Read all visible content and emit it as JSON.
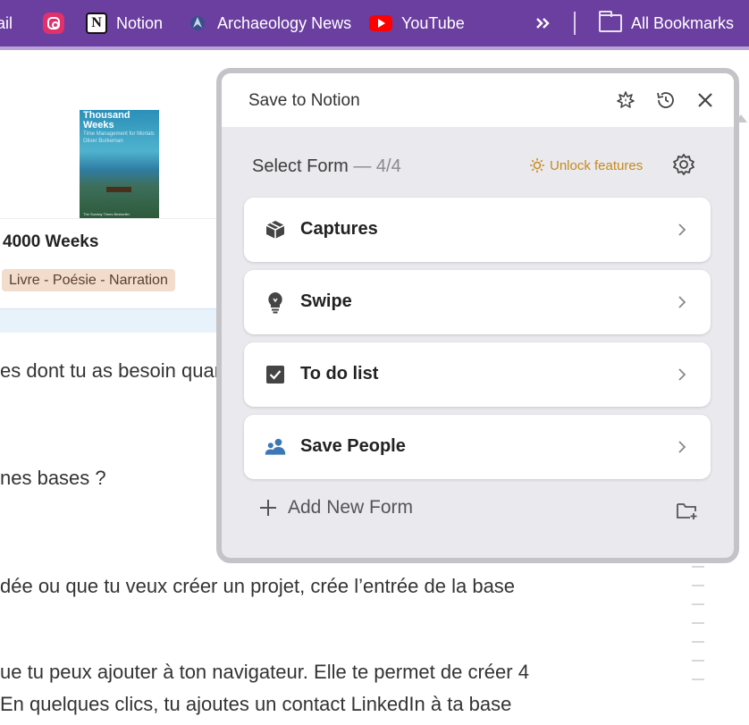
{
  "bookmarks_bar": {
    "items": [
      {
        "label": "ail",
        "icon": "mail-icon"
      },
      {
        "label": "",
        "icon": "instagram-icon"
      },
      {
        "label": "Notion",
        "icon": "notion-icon",
        "icon_glyph": "N"
      },
      {
        "label": "Archaeology News",
        "icon": "compass-icon"
      },
      {
        "label": "YouTube",
        "icon": "youtube-icon"
      }
    ],
    "overflow_icon": "double-chevron-icon",
    "all_bookmarks": {
      "label": "All Bookmarks",
      "icon": "folder-icon"
    },
    "colors": {
      "background": "#6b3fa0",
      "text": "#ffffff"
    }
  },
  "page": {
    "book": {
      "cover_title": "Thousand Weeks",
      "cover_subtitle": "Time Management for Mortals",
      "cover_author": "Oliver Burkeman",
      "cover_footer": "The Sunday Times Bestseller"
    },
    "card_title": "4000 Weeks",
    "tag": "Livre - Poésie - Narration",
    "paragraphs": [
      "es dont tu as besoin quan",
      "nes bases ?",
      "dée ou que tu veux créer un projet, crée l’entrée de la base",
      "ue tu peux ajouter à ton navigateur. Elle te permet de créer 4",
      "En quelques clics, tu ajoutes un contact LinkedIn à ta base"
    ]
  },
  "popup": {
    "title": "Save to Notion",
    "header_icons": [
      "sparkle-icon",
      "history-icon",
      "close-icon"
    ],
    "select_label": "Select Form",
    "select_count": "— 4/4",
    "unlock_label": "Unlock features",
    "settings_icon": "gear-icon",
    "forms": [
      {
        "label": "Captures",
        "icon": "box-icon",
        "icon_color": "#444444"
      },
      {
        "label": "Swipe",
        "icon": "lightbulb-icon",
        "icon_color": "#444444"
      },
      {
        "label": "To do list",
        "icon": "checkbox-icon",
        "icon_color": "#444444"
      },
      {
        "label": "Save People",
        "icon": "people-icon",
        "icon_color": "#3b78b5"
      }
    ],
    "add_form_label": "Add New Form",
    "add_icon": "plus-icon",
    "new_folder_icon": "folder-plus-icon",
    "colors": {
      "accent": "#c88a1a",
      "panel": "#e9e9ee",
      "card": "#ffffff"
    }
  }
}
